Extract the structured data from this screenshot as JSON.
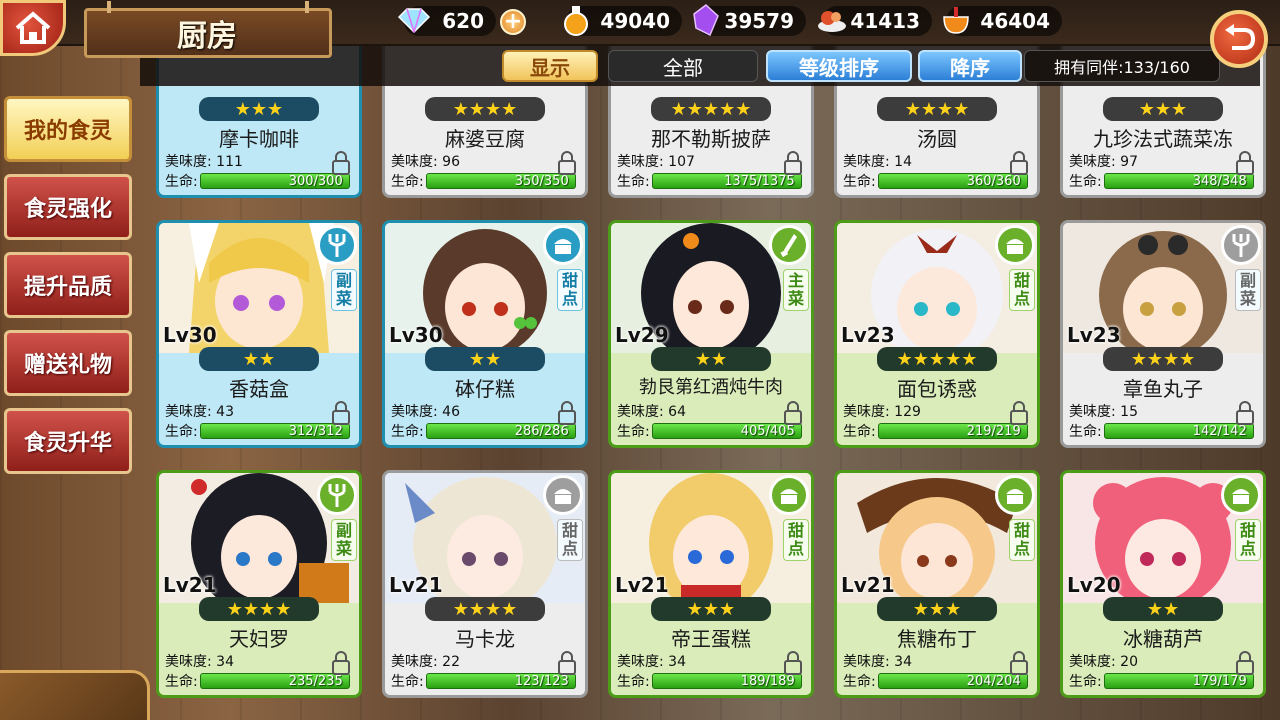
{
  "header": {
    "title": "厨房",
    "resources": [
      {
        "icon": "crystal-icon",
        "value": "620",
        "has_plus": true
      },
      {
        "icon": "potion-icon",
        "value": "49040"
      },
      {
        "icon": "magic-crystal-icon",
        "value": "39579"
      },
      {
        "icon": "food-tray-icon",
        "value": "41413"
      },
      {
        "icon": "bowl-icon",
        "value": "46404"
      }
    ]
  },
  "filters": {
    "show": "显示",
    "all": "全部",
    "sort_level": "等级排序",
    "order_desc": "降序",
    "owned": "拥有同伴:133/160"
  },
  "sidebar": {
    "items": [
      {
        "label": "我的食灵",
        "active": true
      },
      {
        "label": "食灵强化",
        "active": false
      },
      {
        "label": "提升品质",
        "active": false
      },
      {
        "label": "赠送礼物",
        "active": false
      },
      {
        "label": "食灵升华",
        "active": false
      }
    ]
  },
  "labels": {
    "tasty": "美味度:",
    "hp": "生命:"
  },
  "cards": [
    {
      "name": "摩卡咖啡",
      "stars": "★★★",
      "tasty": "111",
      "hp": "300/300",
      "theme": "blue"
    },
    {
      "name": "麻婆豆腐",
      "stars": "★★★★",
      "tasty": "96",
      "hp": "350/350",
      "theme": "gray"
    },
    {
      "name": "那不勒斯披萨",
      "stars": "★★★★★",
      "tasty": "107",
      "hp": "1375/1375",
      "theme": "gray"
    },
    {
      "name": "汤圆",
      "stars": "★★★★",
      "tasty": "14",
      "hp": "360/360",
      "theme": "gray"
    },
    {
      "name": "九珍法式蔬菜冻",
      "stars": "★★★",
      "tasty": "97",
      "hp": "348/348",
      "theme": "gray"
    },
    {
      "name": "香菇盒",
      "lv": "Lv30",
      "stars": "★★",
      "tasty": "43",
      "hp": "312/312",
      "type": "副菜",
      "type_icon": "fork-icon",
      "theme": "blue"
    },
    {
      "name": "砵仔糕",
      "lv": "Lv30",
      "stars": "★★",
      "tasty": "46",
      "hp": "286/286",
      "type": "甜点",
      "type_icon": "cake-icon",
      "theme": "blue"
    },
    {
      "name": "勃艮第红酒炖牛肉",
      "lv": "Lv29",
      "stars": "★★",
      "tasty": "64",
      "hp": "405/405",
      "type": "主菜",
      "type_icon": "knife-icon",
      "theme": "green"
    },
    {
      "name": "面包诱惑",
      "lv": "Lv23",
      "stars": "★★★★★",
      "tasty": "129",
      "hp": "219/219",
      "type": "甜点",
      "type_icon": "cake-icon",
      "theme": "green"
    },
    {
      "name": "章鱼丸子",
      "lv": "Lv23",
      "stars": "★★★★",
      "tasty": "15",
      "hp": "142/142",
      "type": "副菜",
      "type_icon": "fork-icon",
      "theme": "gray"
    },
    {
      "name": "天妇罗",
      "lv": "Lv21",
      "stars": "★★★★",
      "tasty": "34",
      "hp": "235/235",
      "type": "副菜",
      "type_icon": "fork-icon",
      "theme": "green"
    },
    {
      "name": "马卡龙",
      "lv": "Lv21",
      "stars": "★★★★",
      "tasty": "22",
      "hp": "123/123",
      "type": "甜点",
      "type_icon": "cake-icon",
      "theme": "gray"
    },
    {
      "name": "帝王蛋糕",
      "lv": "Lv21",
      "stars": "★★★",
      "tasty": "34",
      "hp": "189/189",
      "type": "甜点",
      "type_icon": "cake-icon",
      "theme": "green"
    },
    {
      "name": "焦糖布丁",
      "lv": "Lv21",
      "stars": "★★★",
      "tasty": "34",
      "hp": "204/204",
      "type": "甜点",
      "type_icon": "cake-icon",
      "theme": "green"
    },
    {
      "name": "冰糖葫芦",
      "lv": "Lv20",
      "stars": "★★",
      "tasty": "20",
      "hp": "179/179",
      "type": "甜点",
      "type_icon": "cake-icon",
      "theme": "green"
    }
  ]
}
